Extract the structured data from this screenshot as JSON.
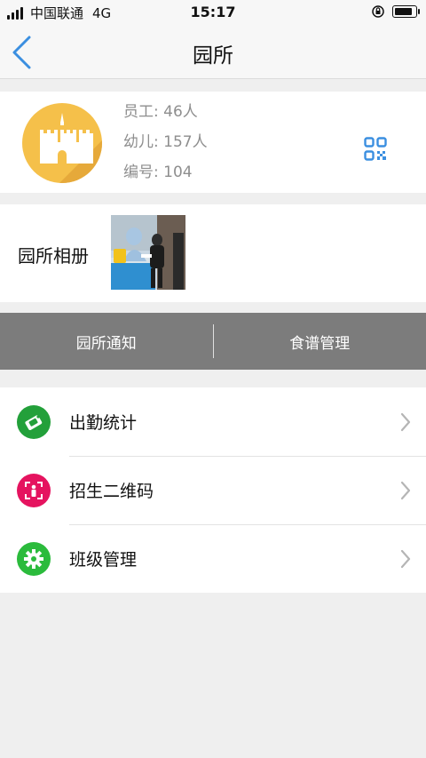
{
  "status_bar": {
    "carrier": "中国联通",
    "network": "4G",
    "time": "15:17"
  },
  "header": {
    "title": "园所",
    "back_icon": "chevron-left-icon"
  },
  "profile": {
    "avatar_icon": "castle-icon",
    "staff": "员工: 46人",
    "children": "幼儿: 157人",
    "number": "编号: 104",
    "qr_icon": "qr-code-icon"
  },
  "album": {
    "label": "园所相册",
    "photo_icon": "photo-thumbnail"
  },
  "tabs": [
    {
      "label": "园所通知"
    },
    {
      "label": "食谱管理"
    }
  ],
  "menu": {
    "items": [
      {
        "label": "出勤统计",
        "icon": "attendance-scanner-icon",
        "color": "#23a03a"
      },
      {
        "label": "招生二维码",
        "icon": "enrollment-person-icon",
        "color": "#e5135f"
      },
      {
        "label": "班级管理",
        "icon": "gear-icon",
        "color": "#2bbb3c"
      }
    ]
  },
  "colors": {
    "accent": "#3b8fe0",
    "tab_background": "#7c7c7c",
    "avatar_background": "#f5c04a"
  }
}
